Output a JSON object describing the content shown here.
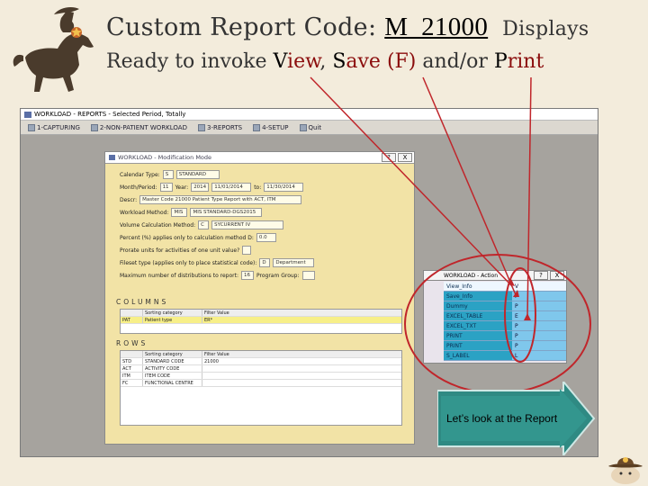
{
  "slide": {
    "title_prefix": "Custom Report Code: ",
    "report_code": "M_21000",
    "title_suffix": "Displays",
    "line2": {
      "lead": "Ready to invoke ",
      "view_first": "V",
      "view_rest": "iew",
      "comma1": ", ",
      "save_first": "S",
      "save_rest": "ave",
      "save_paren": " (F)",
      "and_or": " and/or ",
      "print_first": "P",
      "print_rest": "rint"
    },
    "callout": "Let’s look at the Report"
  },
  "app": {
    "title": "WORKLOAD - REPORTS - Selected Period, Totally",
    "menu": [
      {
        "label": "1-CAPTURING",
        "icon": "capture-icon"
      },
      {
        "label": "2-NON-PATIENT WORKLOAD",
        "icon": "workload-icon"
      },
      {
        "label": "3-REPORTS",
        "icon": "reports-icon"
      },
      {
        "label": "4-SETUP",
        "icon": "setup-icon"
      },
      {
        "label": "Quit",
        "icon": "quit-icon"
      }
    ]
  },
  "modal": {
    "title": "WORKLOAD - Modification Mode",
    "help_btn": "?",
    "close_btn": "X",
    "calendar_label": "Calendar Type:",
    "calendar_code": "S",
    "calendar_value": "STANDARD",
    "month_label": "Month/Period:",
    "month_value": "11",
    "year_label": "Year:",
    "year_value": "2014",
    "date_from": "11/01/2014",
    "to_label": "to:",
    "date_to": "11/30/2014",
    "descr_label": "Descr:",
    "descr_value": "Master Code 21000 Patient Type Report with ACT, ITM",
    "workload_label": "Workload Method:",
    "workload_code": "MIS",
    "workload_value": "MIS STANDARD-DGS2015",
    "volume_label": "Volume Calculation Method:",
    "volume_code": "C",
    "volume_value": "SYCURRENT IV",
    "percent_label": "Percent (%) applies only to calculation method D:",
    "percent_value": "0.0",
    "prorate_label": "Prorate units for activities of one unit value?",
    "fileset_label": "Fileset type (applies only to place statistical code):",
    "fileset_code": "D",
    "fileset_value": "Department",
    "maxdist_label": "Maximum number of distributions to report:",
    "maxdist_value": "16",
    "program_label": "Program Group:",
    "columns_header": "COLUMNS",
    "columns_grid": {
      "headers": [
        "",
        "Sorting category",
        "Filter Value"
      ],
      "rows": [
        [
          "PAT",
          "Patient type",
          "ER*"
        ]
      ]
    },
    "rows_header": "ROWS",
    "rows_grid": {
      "headers": [
        "",
        "Sorting category",
        "Filter Value"
      ],
      "rows": [
        [
          "STD",
          "STANDARD CODE",
          "21000"
        ],
        [
          "ACT",
          "ACTIVITY CODE",
          ""
        ],
        [
          "ITM",
          "ITEM CODE",
          ""
        ],
        [
          "FC",
          "FUNCTIONAL CENTRE",
          ""
        ]
      ]
    }
  },
  "popup": {
    "title": "WORKLOAD - Action",
    "help_btn": "?",
    "close_btn": "X",
    "items": [
      {
        "name": "View_Info",
        "value": "V"
      },
      {
        "name": "Save_Info",
        "value": "F"
      },
      {
        "name": "Dummy",
        "value": "P"
      },
      {
        "name": "EXCEL_TABLE",
        "value": "E"
      },
      {
        "name": "EXCEL_TXT",
        "value": "P"
      },
      {
        "name": "PRINT",
        "value": "P"
      },
      {
        "name": "PRINT",
        "value": "P"
      },
      {
        "name": "S_LABEL",
        "value": "L"
      }
    ]
  },
  "colors": {
    "accent_red": "#c0262b",
    "arrow_fill": "#2f8a83",
    "modal_bg": "#f2e3a6",
    "popup_item": "#2ba2c4"
  }
}
